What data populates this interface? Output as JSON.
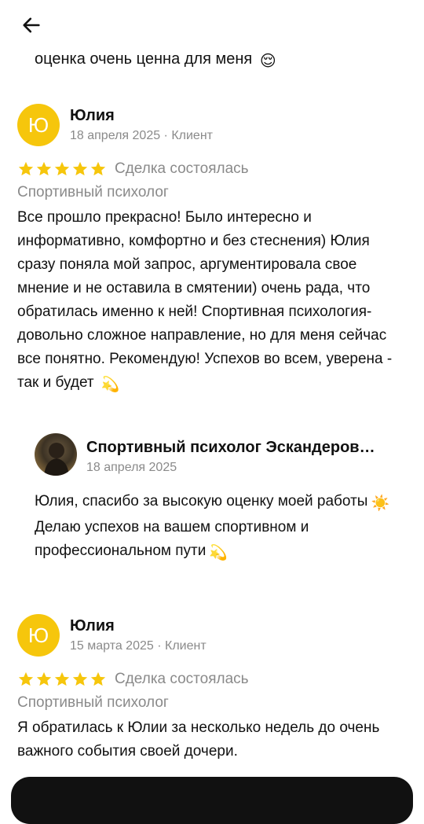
{
  "header": {
    "back_icon": "arrow-left-icon"
  },
  "previous_review_tail": {
    "text": "оценка очень ценна для меня",
    "emoji": "😌"
  },
  "reviews": [
    {
      "avatar_letter": "Ю",
      "author": "Юлия",
      "meta": "18 апреля 2025 · Клиент",
      "rating": 5,
      "deal_status": "Сделка состоялась",
      "category": "Спортивный психолог",
      "text": "Все прошло прекрасно! Было интересно и информативно, комфортно и без стеснения) Юлия сразу поняла мой запрос, аргументировала свое мнение и не оставила в смятении) очень рада, что обратилась именно к ней! Спортивная психология- довольно сложное направление, но для меня сейчас все понятно. Рекомендую! Успехов во всем, уверена - так и будет",
      "text_emoji": "💫",
      "reply": {
        "author": "Спортивный психолог Эскандеров…",
        "meta": "18 апреля 2025",
        "text_line1": "Юлия, спасибо за высокую оценку моей работы",
        "emoji1": "☀️",
        "text_line2": "Делаю успехов на вашем спортивном и профессиональном пути",
        "emoji2": "💫"
      }
    },
    {
      "avatar_letter": "Ю",
      "author": "Юлия",
      "meta": "15 марта 2025 · Клиент",
      "rating": 5,
      "deal_status": "Сделка состоялась",
      "category": "Спортивный психолог",
      "text": "Я обратилась к Юлии за несколько недель до очень важного события своей дочери."
    }
  ],
  "colors": {
    "star": "#f6c60c",
    "avatar": "#f6c60c",
    "muted_text": "#8a8a8a",
    "bottom_bar": "#111111"
  }
}
